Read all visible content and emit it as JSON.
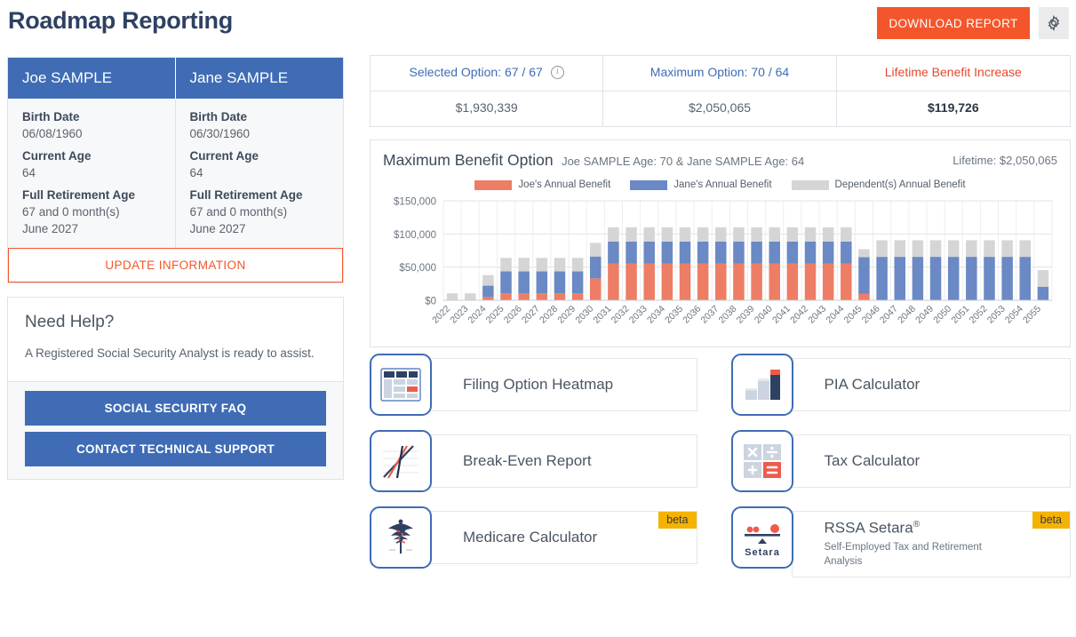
{
  "header": {
    "title": "Roadmap Reporting",
    "download_label": "DOWNLOAD REPORT",
    "settings_icon": "gear-icon"
  },
  "people": [
    {
      "name": "Joe SAMPLE",
      "birth_date_label": "Birth Date",
      "birth_date": "06/08/1960",
      "current_age_label": "Current Age",
      "current_age": "64",
      "fra_label": "Full Retirement Age",
      "fra_value": "67 and 0 month(s)",
      "fra_date": "June 2027"
    },
    {
      "name": "Jane SAMPLE",
      "birth_date_label": "Birth Date",
      "birth_date": "06/30/1960",
      "current_age_label": "Current Age",
      "current_age": "64",
      "fra_label": "Full Retirement Age",
      "fra_value": "67 and 0 month(s)",
      "fra_date": "June 2027"
    }
  ],
  "update_button": "UPDATE INFORMATION",
  "help": {
    "title": "Need Help?",
    "text": "A Registered Social Security Analyst is ready to assist.",
    "faq_button": "SOCIAL SECURITY FAQ",
    "support_button": "CONTACT TECHNICAL SUPPORT"
  },
  "summary": {
    "columns": [
      {
        "header": "Selected Option: 67 / 67",
        "value": "$1,930,339",
        "has_info_icon": true,
        "accent": false,
        "bold": false
      },
      {
        "header": "Maximum Option: 70 / 64",
        "value": "$2,050,065",
        "has_info_icon": false,
        "accent": false,
        "bold": false
      },
      {
        "header": "Lifetime Benefit Increase",
        "value": "$119,726",
        "has_info_icon": false,
        "accent": true,
        "bold": true
      }
    ]
  },
  "chart_panel": {
    "title": "Maximum Benefit Option",
    "subtitle": "Joe SAMPLE Age: 70 & Jane SAMPLE Age: 64",
    "lifetime": "Lifetime: $2,050,065"
  },
  "chart_data": {
    "type": "bar",
    "stacked": true,
    "title": "Maximum Benefit Option",
    "xlabel": "",
    "ylabel": "",
    "ylim": [
      0,
      150000
    ],
    "yticks": [
      0,
      50000,
      100000,
      150000
    ],
    "ytick_labels": [
      "$0",
      "$50,000",
      "$100,000",
      "$150,000"
    ],
    "grid": true,
    "legend_position": "top-center",
    "categories": [
      "2022",
      "2023",
      "2024",
      "2025",
      "2026",
      "2027",
      "2028",
      "2029",
      "2030",
      "2031",
      "2032",
      "2033",
      "2034",
      "2035",
      "2036",
      "2037",
      "2038",
      "2039",
      "2040",
      "2041",
      "2042",
      "2043",
      "2044",
      "2045",
      "2046",
      "2047",
      "2048",
      "2049",
      "2050",
      "2051",
      "2052",
      "2053",
      "2054",
      "2055"
    ],
    "series": [
      {
        "name": "Joe's Annual Benefit",
        "color": "#ED7D64",
        "values": [
          0,
          0,
          5000,
          10500,
          10500,
          10500,
          10500,
          10500,
          33000,
          55500,
          55500,
          55500,
          55500,
          55500,
          55500,
          55500,
          55500,
          55500,
          55500,
          55500,
          55500,
          55500,
          55500,
          10000,
          0,
          0,
          0,
          0,
          0,
          0,
          0,
          0,
          0,
          0
        ]
      },
      {
        "name": "Jane's Annual Benefit",
        "color": "#6A89C5",
        "values": [
          0,
          0,
          17000,
          33000,
          33000,
          33000,
          33000,
          33000,
          33000,
          33000,
          33000,
          33000,
          33000,
          33000,
          33000,
          33000,
          33000,
          33000,
          33000,
          33000,
          33000,
          33000,
          33000,
          55000,
          65500,
          65500,
          65500,
          65500,
          65500,
          65500,
          65500,
          65500,
          65500,
          20500
        ]
      },
      {
        "name": "Dependent(s) Annual Benefit",
        "color": "#D5D5D5",
        "values": [
          10500,
          10500,
          16000,
          20500,
          20500,
          20500,
          20500,
          20500,
          20500,
          21500,
          21500,
          21500,
          21500,
          21500,
          21500,
          21500,
          21500,
          21500,
          21500,
          21500,
          21500,
          21500,
          21500,
          12000,
          25000,
          25000,
          25000,
          25000,
          25000,
          25000,
          25000,
          25000,
          25000,
          25000
        ]
      }
    ]
  },
  "tools": {
    "left": [
      {
        "label": "Filing Option Heatmap",
        "icon": "heatmap-table-icon",
        "sub": "",
        "beta": false
      },
      {
        "label": "Break-Even Report",
        "icon": "line-chart-icon",
        "sub": "",
        "beta": false
      },
      {
        "label": "Medicare Calculator",
        "icon": "caduceus-icon",
        "sub": "",
        "beta": true,
        "beta_label": "beta"
      }
    ],
    "right": [
      {
        "label": "PIA Calculator",
        "icon": "bar-chart-icon",
        "sub": "",
        "beta": false
      },
      {
        "label": "Tax Calculator",
        "icon": "calculator-icon",
        "sub": "",
        "beta": false
      },
      {
        "label": "RSSA Setara",
        "reg": "®",
        "icon": "setara-scale-icon",
        "sub": "Self-Employed Tax and Retirement Analysis",
        "beta": true,
        "beta_label": "beta"
      }
    ]
  },
  "colors": {
    "brand_blue": "#3f6cb5",
    "accent_orange": "#f4562b",
    "title_navy": "#2e4163",
    "beta_yellow": "#f5b301",
    "series_joe": "#ED7D64",
    "series_jane": "#6A89C5",
    "series_dependent": "#D5D5D5"
  }
}
